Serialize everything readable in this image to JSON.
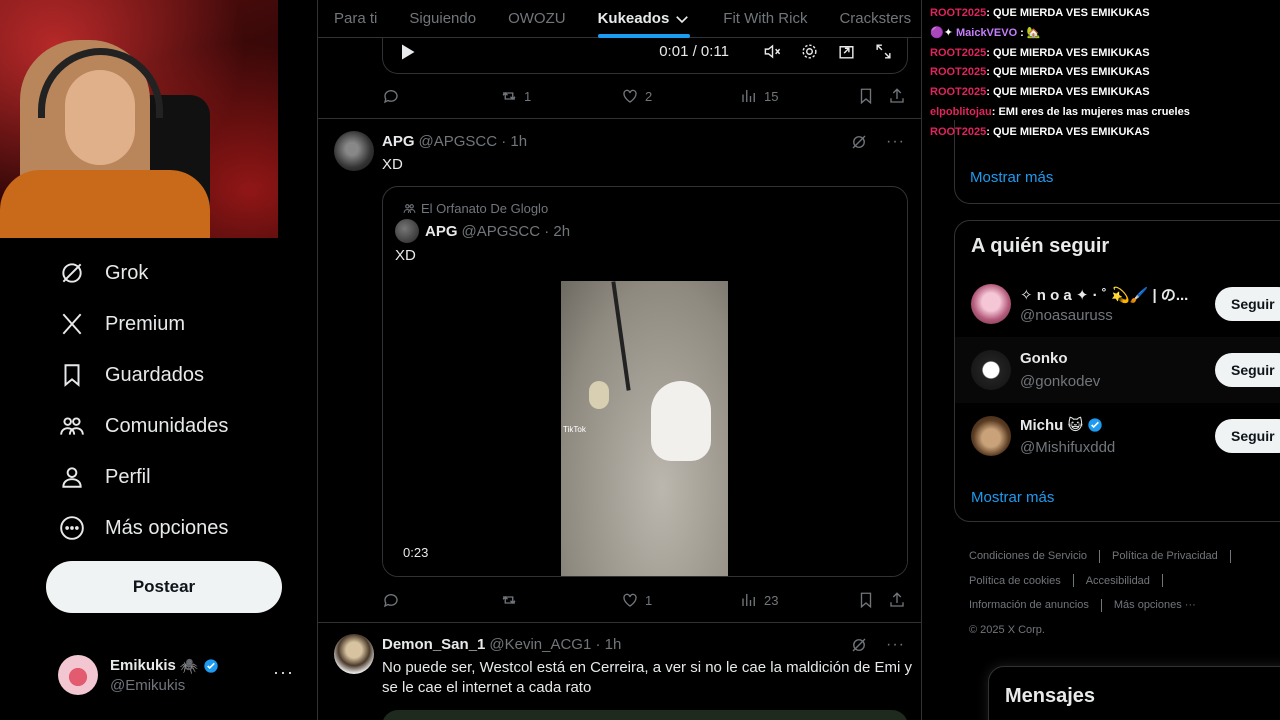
{
  "left": {
    "nav": [
      {
        "label": "Grok",
        "icon": "grok-icon"
      },
      {
        "label": "Premium",
        "icon": "x-logo-icon"
      },
      {
        "label": "Guardados",
        "icon": "bookmark-icon"
      },
      {
        "label": "Comunidades",
        "icon": "communities-icon"
      },
      {
        "label": "Perfil",
        "icon": "person-icon"
      },
      {
        "label": "Más opciones",
        "icon": "more-circle-icon"
      }
    ],
    "post_button": "Postear",
    "account": {
      "display_name": "Emikukis",
      "emoji": "🕷️",
      "handle": "@Emikukis",
      "more": "···"
    }
  },
  "feed": {
    "tabs": [
      {
        "label": "Para ti",
        "active": false
      },
      {
        "label": "Siguiendo",
        "active": false
      },
      {
        "label": "OWOZU",
        "active": false
      },
      {
        "label": "Kukeados",
        "active": true,
        "chevron": true
      },
      {
        "label": "Fit With Rick",
        "active": false
      },
      {
        "label": "Cracksters",
        "active": false
      }
    ],
    "player": {
      "time": "0:01 / 0:11"
    },
    "actions_1": {
      "retweets": "1",
      "likes": "2",
      "views": "15"
    },
    "tweet_1": {
      "name": "APG",
      "handle": "@APGSCC · 1h",
      "text": "XD",
      "quote": {
        "community": "El Orfanato De Gloglo",
        "name": "APG",
        "handle": "@APGSCC · 2h",
        "text": "XD",
        "watermark": "TikTok",
        "duration": "0:23"
      },
      "actions": {
        "retweets": "",
        "likes": "1",
        "views": "23"
      }
    },
    "tweet_2": {
      "name": "Demon_San_1",
      "handle": "@Kevin_ACG1 · 1h",
      "text": "No puede ser, Westcol está en Cerreira, a ver si no le cae la maldición de Emi y se le cae el internet a cada rato"
    }
  },
  "chat": [
    {
      "user": "ROOT2025",
      "color": "#e0245e",
      "msg": ": QUE MIERDA VES EMIKUKAS"
    },
    {
      "user": "MaickVEVO",
      "color": "#c77dff",
      "prefix": "🟣✦ ",
      "msg": " : 🏡"
    },
    {
      "user": "ROOT2025",
      "color": "#e0245e",
      "msg": ": QUE MIERDA VES EMIKUKAS"
    },
    {
      "user": "ROOT2025",
      "color": "#e0245e",
      "msg": ": QUE MIERDA VES EMIKUKAS"
    },
    {
      "user": "ROOT2025",
      "color": "#e0245e",
      "msg": ": QUE MIERDA VES EMIKUKAS"
    },
    {
      "user": "elpoblitojau",
      "color": "#e0245e",
      "msg": ": EMI eres de las mujeres mas crueles"
    },
    {
      "user": "ROOT2025",
      "color": "#e0245e",
      "msg": ": QUE MIERDA VES EMIKUKAS"
    }
  ],
  "right": {
    "show_more_1": "Mostrar más",
    "follow": {
      "title": "A quién seguir",
      "users": [
        {
          "name": "✧ n o a ✦ · ˚ 💫🖌️ | の...",
          "handle": "@noasauruss",
          "verified": false,
          "button": "Seguir"
        },
        {
          "name": "Gonko",
          "handle": "@gonkodev",
          "verified": false,
          "button": "Seguir"
        },
        {
          "name": "Michu 😺",
          "handle": "@Mishifuxddd",
          "verified": true,
          "button": "Seguir"
        }
      ],
      "show_more": "Mostrar más"
    },
    "footer": {
      "links": [
        "Condiciones de Servicio",
        "Política de Privacidad",
        "Política de cookies",
        "Accesibilidad",
        "Información de anuncios",
        "Más opciones ···"
      ],
      "copyright": "© 2025 X Corp."
    },
    "messages": "Mensajes"
  },
  "colors": {
    "accent": "#1d9bf0",
    "border": "#2f3336",
    "muted": "#71767b",
    "text": "#e7e9ea"
  }
}
